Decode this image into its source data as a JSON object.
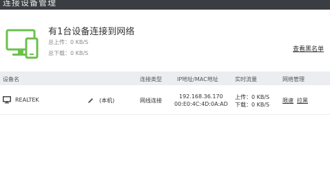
{
  "window": {
    "title": "连接设备管理"
  },
  "summary": {
    "headline": "有1台设备连接到网络",
    "upload_total": "总上传：0 KB/S",
    "download_total": "总下载：0 KB/S",
    "blacklist_link": "查看黑名单"
  },
  "table": {
    "headers": {
      "device_name": "设备名",
      "connection_type": "连接类型",
      "ip_mac": "IP地址/MAC地址",
      "realtime_traffic": "实时流量",
      "network_mgmt": "网络管理"
    },
    "rows": [
      {
        "device_name": "REALTEK",
        "local_tag": "(本机)",
        "connection_type": "网线连接",
        "ip": "192.168.36.170",
        "mac": "00:E0:4C:4D:0A:AD",
        "upload": "上传：0 KB/S",
        "download": "下载：0 KB/S",
        "action_limit": "限速",
        "action_block": "拉黑"
      }
    ]
  },
  "colors": {
    "accent_green": "#6bc04b",
    "title_bar": "#3a3d42",
    "table_header_bg": "#ebedf0"
  },
  "icons": {
    "device_icon": "monitor-phone-icon",
    "row_icon": "desktop-monitor-icon",
    "edit_icon": "pencil-icon"
  }
}
